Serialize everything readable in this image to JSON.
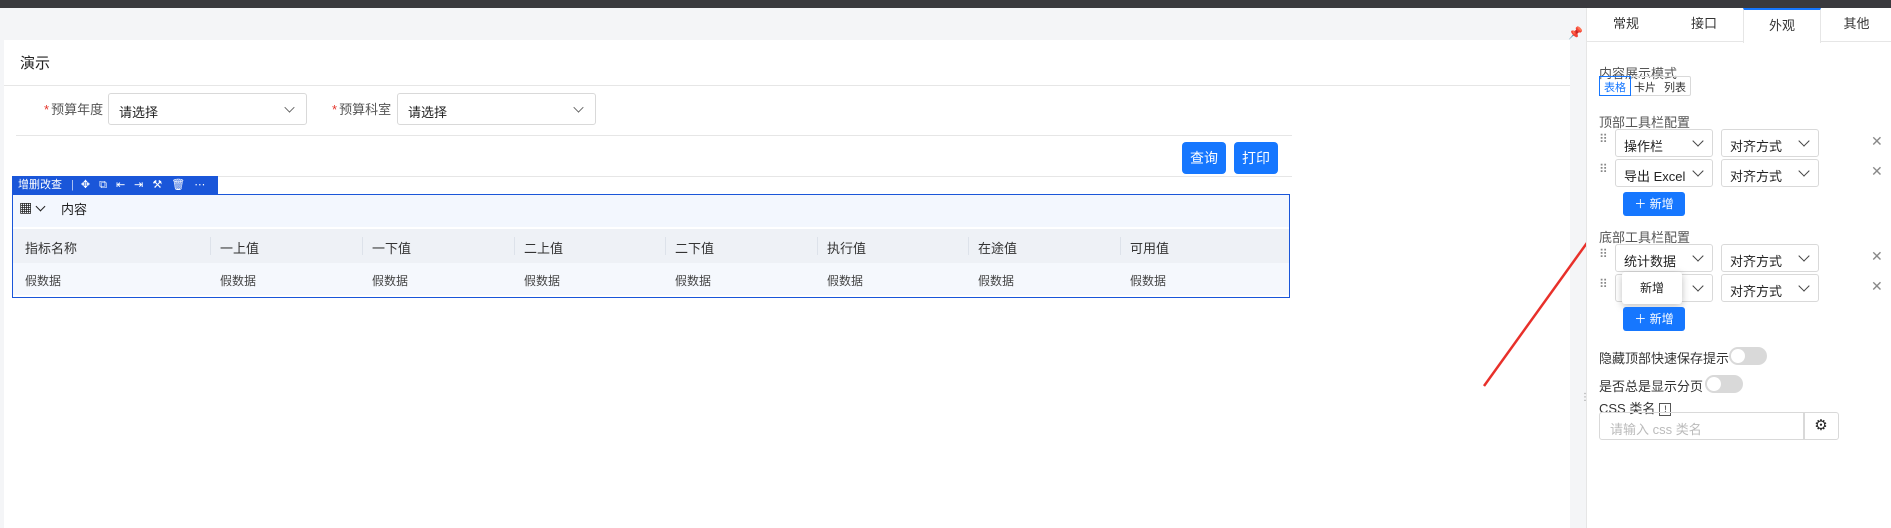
{
  "page": {
    "title": "演示",
    "filters": [
      {
        "label": "预算年度",
        "required": true,
        "placeholder": "请选择"
      },
      {
        "label": "预算科室",
        "required": true,
        "placeholder": "请选择"
      }
    ],
    "buttons": {
      "query": "查询",
      "print": "打印"
    }
  },
  "edit_bar": {
    "label": "增删改查",
    "icons": [
      "move-icon",
      "copy-icon",
      "insert-left-icon",
      "insert-right-icon",
      "hammer-icon",
      "delete-icon",
      "more-icon"
    ]
  },
  "table": {
    "content_label": "内容",
    "columns": [
      "指标名称",
      "一上值",
      "一下值",
      "二上值",
      "二下值",
      "执行值",
      "在途值",
      "可用值"
    ],
    "rows": [
      [
        "假数据",
        "假数据",
        "假数据",
        "假数据",
        "假数据",
        "假数据",
        "假数据",
        "假数据"
      ]
    ]
  },
  "panel": {
    "tabs": [
      "常规",
      "接口",
      "外观",
      "其他"
    ],
    "active_tab": "外观",
    "display_mode": {
      "label": "内容展示模式",
      "options": [
        "表格",
        "卡片",
        "列表"
      ],
      "selected": "表格"
    },
    "top_toolbar": {
      "label": "顶部工具栏配置",
      "items": [
        {
          "value": "操作栏",
          "align": "对齐方式"
        },
        {
          "value": "导出 Excel",
          "align": "对齐方式"
        }
      ],
      "add_label": "新增"
    },
    "bottom_toolbar": {
      "label": "底部工具栏配置",
      "items": [
        {
          "value": "统计数据",
          "align": "对齐方式"
        },
        {
          "value": "",
          "align": "对齐方式"
        }
      ],
      "add_label": "新增",
      "tooltip": "新增"
    },
    "switches": [
      {
        "label": "隐藏顶部快速保存提示",
        "on": false
      },
      {
        "label": "是否总是显示分页",
        "on": false
      }
    ],
    "css": {
      "label": "CSS 类名",
      "info": "!",
      "placeholder": "请输入 css 类名"
    }
  },
  "colors": {
    "primary": "#1677ff",
    "edit_border": "#1a56d9",
    "arrow": "#e8302a"
  }
}
